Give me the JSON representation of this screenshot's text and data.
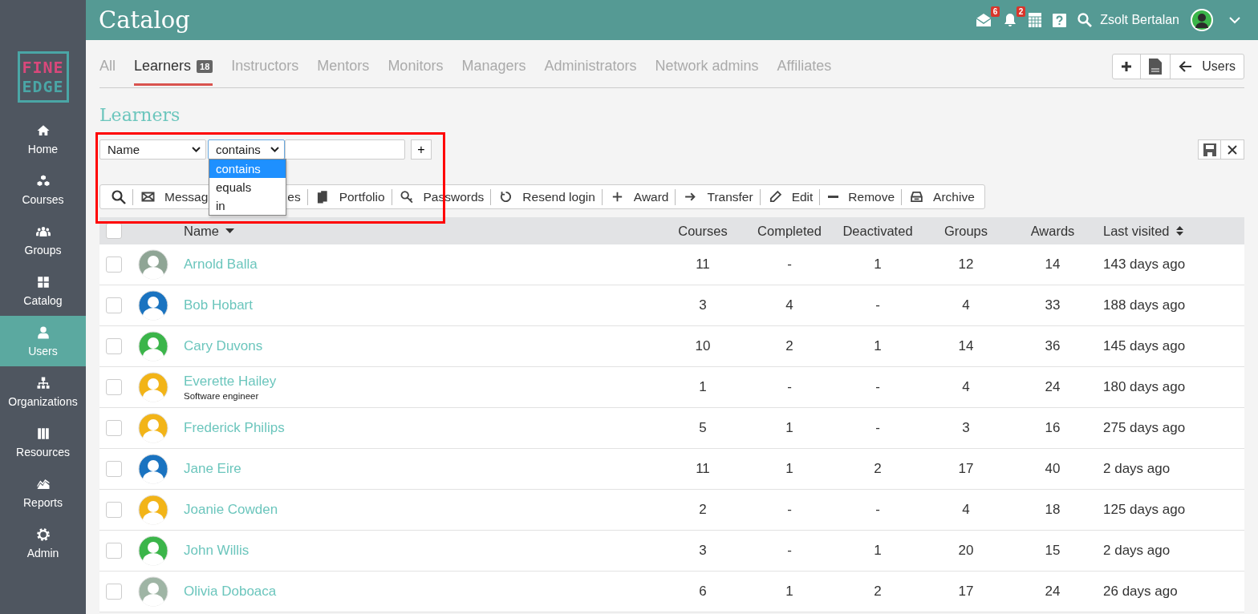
{
  "topbar": {
    "title": "Catalog",
    "mail_count": "6",
    "notification_count": "2",
    "user_name": "Zsolt Bertalan"
  },
  "logo": {
    "line1": "FINE",
    "line2": "EDGE"
  },
  "sidebar": {
    "items": [
      {
        "label": "Home",
        "selected": false
      },
      {
        "label": "Courses",
        "selected": false
      },
      {
        "label": "Groups",
        "selected": false
      },
      {
        "label": "Catalog",
        "selected": false
      },
      {
        "label": "Users",
        "selected": true
      },
      {
        "label": "Organizations",
        "selected": false
      },
      {
        "label": "Resources",
        "selected": false
      },
      {
        "label": "Reports",
        "selected": false
      },
      {
        "label": "Admin",
        "selected": false
      }
    ]
  },
  "tabs": [
    {
      "label": "All",
      "selected": false
    },
    {
      "label": "Learners",
      "badge": "18",
      "selected": true
    },
    {
      "label": "Instructors",
      "selected": false
    },
    {
      "label": "Mentors",
      "selected": false
    },
    {
      "label": "Monitors",
      "selected": false
    },
    {
      "label": "Managers",
      "selected": false
    },
    {
      "label": "Administrators",
      "selected": false
    },
    {
      "label": "Network admins",
      "selected": false
    },
    {
      "label": "Affiliates",
      "selected": false
    }
  ],
  "header_actions": {
    "back_label": "Users"
  },
  "heading": "Learners",
  "filter": {
    "field": "Name",
    "operator": "contains",
    "options": [
      {
        "label": "contains",
        "selected": true
      },
      {
        "label": "equals",
        "selected": false
      },
      {
        "label": "in",
        "selected": false
      }
    ],
    "add_label": "+"
  },
  "annotation": {
    "kind": "highlight-box"
  },
  "toolbar": [
    {
      "kind": "icon-only"
    },
    {
      "kind": "action",
      "label": "Messag"
    },
    {
      "kind": "covered",
      "label": "es"
    },
    {
      "kind": "action",
      "label": "Portfolio"
    },
    {
      "kind": "action",
      "label": "Passwords"
    },
    {
      "kind": "action",
      "label": "Resend login"
    },
    {
      "kind": "action",
      "label": "Award"
    },
    {
      "kind": "action",
      "label": "Transfer"
    },
    {
      "kind": "action",
      "label": "Edit"
    },
    {
      "kind": "action",
      "label": "Remove"
    },
    {
      "kind": "action",
      "label": "Archive"
    }
  ],
  "table": {
    "select_all_checked": false,
    "columns": [
      "Name",
      "Courses",
      "Completed",
      "Deactivated",
      "Groups",
      "Awards",
      "Last visited"
    ],
    "rows": [
      {
        "name": "Arnold Balla",
        "color": "#8fa595",
        "checked": false,
        "courses": "11",
        "completed": "-",
        "deactivated": "1",
        "groups": "12",
        "awards": "14",
        "last_visited": "143 days ago"
      },
      {
        "name": "Bob Hobart",
        "color": "#1a73c0",
        "checked": false,
        "courses": "3",
        "completed": "4",
        "deactivated": "-",
        "groups": "4",
        "awards": "33",
        "last_visited": "188 days ago"
      },
      {
        "name": "Cary Duvons",
        "color": "#3bb54a",
        "checked": false,
        "courses": "10",
        "completed": "2",
        "deactivated": "1",
        "groups": "14",
        "awards": "36",
        "last_visited": "145 days ago"
      },
      {
        "name": "Everette Hailey",
        "subtitle": "Software engineer",
        "color": "#f2b418",
        "checked": false,
        "courses": "1",
        "completed": "-",
        "deactivated": "-",
        "groups": "4",
        "awards": "24",
        "last_visited": "180 days ago"
      },
      {
        "name": "Frederick Philips",
        "color": "#f2b418",
        "checked": false,
        "courses": "5",
        "completed": "1",
        "deactivated": "-",
        "groups": "3",
        "awards": "16",
        "last_visited": "275 days ago"
      },
      {
        "name": "Jane Eire",
        "color": "#1a73c0",
        "checked": false,
        "courses": "11",
        "completed": "1",
        "deactivated": "2",
        "groups": "17",
        "awards": "40",
        "last_visited": "2 days ago"
      },
      {
        "name": "Joanie Cowden",
        "color": "#f2b418",
        "checked": false,
        "courses": "2",
        "completed": "-",
        "deactivated": "-",
        "groups": "4",
        "awards": "18",
        "last_visited": "125 days ago"
      },
      {
        "name": "John Willis",
        "color": "#3bb54a",
        "checked": false,
        "courses": "3",
        "completed": "-",
        "deactivated": "1",
        "groups": "20",
        "awards": "15",
        "last_visited": "2 days ago"
      },
      {
        "name": "Olivia Doboaca",
        "color": "#9fb5a5",
        "checked": false,
        "courses": "6",
        "completed": "1",
        "deactivated": "2",
        "groups": "17",
        "awards": "24",
        "last_visited": "26 days ago"
      }
    ]
  }
}
